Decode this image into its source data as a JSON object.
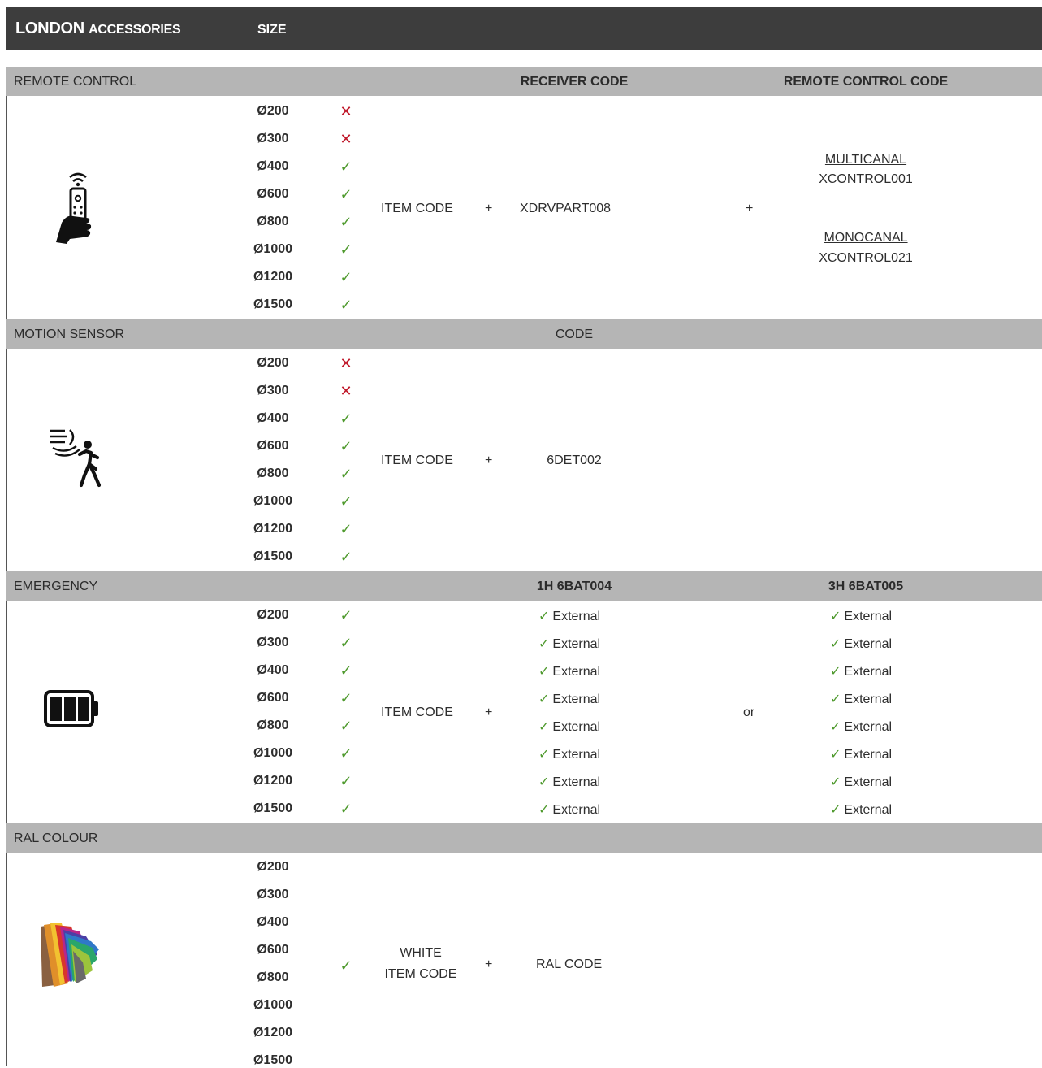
{
  "header": {
    "title_main": "LONDON",
    "title_sub": "ACCESSORIES",
    "size_label": "SIZE"
  },
  "colors": {
    "check": "#4f9a2e",
    "cross": "#c0182a",
    "bar": "#3d3d3d",
    "section": "#b5b5b5"
  },
  "sizes": [
    "Ø200",
    "Ø300",
    "Ø400",
    "Ø600",
    "Ø800",
    "Ø1000",
    "Ø1200",
    "Ø1500"
  ],
  "remote": {
    "label": "REMOTE CONTROL",
    "hdr_receiver": "RECEIVER CODE",
    "hdr_remote": "REMOTE CONTROL CODE",
    "icon": "remote-control-hand-icon",
    "availability": [
      "no",
      "no",
      "yes",
      "yes",
      "yes",
      "yes",
      "yes",
      "yes"
    ],
    "item_code": "ITEM CODE",
    "plus": "+",
    "receiver_code": "XDRVPART008",
    "plus2": "+",
    "multi_label": "MULTICANAL",
    "multi_code": "XCONTROL001",
    "mono_label": "MONOCANAL",
    "mono_code": "XCONTROL021"
  },
  "motion": {
    "label": "MOTION SENSOR",
    "hdr_code": "CODE",
    "icon": "motion-sensor-icon",
    "availability": [
      "no",
      "no",
      "yes",
      "yes",
      "yes",
      "yes",
      "yes",
      "yes"
    ],
    "item_code": "ITEM CODE",
    "plus": "+",
    "code": "6DET002"
  },
  "emergency": {
    "label": "EMERGENCY",
    "hdr_1h": "1H  6BAT004",
    "hdr_3h": "3H  6BAT005",
    "icon": "battery-icon",
    "availability": [
      "yes",
      "yes",
      "yes",
      "yes",
      "yes",
      "yes",
      "yes",
      "yes"
    ],
    "item_code": "ITEM CODE",
    "plus": "+",
    "or": "or",
    "check_symbol": "✓",
    "option_1h": [
      "External",
      "External",
      "External",
      "External",
      "External",
      "External",
      "External",
      "External"
    ],
    "option_3h": [
      "External",
      "External",
      "External",
      "External",
      "External",
      "External",
      "External",
      "External"
    ]
  },
  "ral": {
    "label": "RAL COLOUR",
    "icon": "color-fan-icon",
    "check": "✓",
    "item_line1": "WHITE",
    "item_line2": "ITEM CODE",
    "plus": "+",
    "code": "RAL CODE"
  },
  "symbols": {
    "yes": "✓",
    "no": "✕"
  }
}
